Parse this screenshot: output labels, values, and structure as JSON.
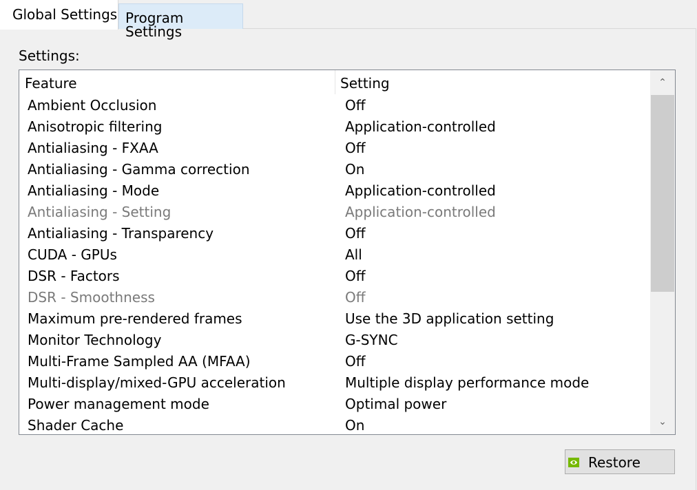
{
  "tabs": {
    "global": "Global Settings",
    "program": "Program Settings"
  },
  "settings_label": "Settings:",
  "table": {
    "columns": [
      "Feature",
      "Setting"
    ],
    "rows": [
      {
        "feature": "Ambient Occlusion",
        "setting": "Off",
        "enabled": true
      },
      {
        "feature": "Anisotropic filtering",
        "setting": "Application-controlled",
        "enabled": true
      },
      {
        "feature": "Antialiasing - FXAA",
        "setting": "Off",
        "enabled": true
      },
      {
        "feature": "Antialiasing - Gamma correction",
        "setting": "On",
        "enabled": true
      },
      {
        "feature": "Antialiasing - Mode",
        "setting": "Application-controlled",
        "enabled": true
      },
      {
        "feature": "Antialiasing - Setting",
        "setting": "Application-controlled",
        "enabled": false
      },
      {
        "feature": "Antialiasing - Transparency",
        "setting": "Off",
        "enabled": true
      },
      {
        "feature": "CUDA - GPUs",
        "setting": "All",
        "enabled": true
      },
      {
        "feature": "DSR - Factors",
        "setting": "Off",
        "enabled": true
      },
      {
        "feature": "DSR - Smoothness",
        "setting": "Off",
        "enabled": false
      },
      {
        "feature": "Maximum pre-rendered frames",
        "setting": "Use the 3D application setting",
        "enabled": true
      },
      {
        "feature": "Monitor Technology",
        "setting": "G-SYNC",
        "enabled": true
      },
      {
        "feature": "Multi-Frame Sampled AA (MFAA)",
        "setting": "Off",
        "enabled": true
      },
      {
        "feature": "Multi-display/mixed-GPU acceleration",
        "setting": "Multiple display performance mode",
        "enabled": true
      },
      {
        "feature": "Power management mode",
        "setting": "Optimal power",
        "enabled": true
      },
      {
        "feature": "Shader Cache",
        "setting": "On",
        "enabled": true
      }
    ]
  },
  "scrollbar": {
    "up_icon": "chevron-up-icon",
    "down_icon": "chevron-down-icon",
    "up_glyph": "⌃",
    "down_glyph": "⌄"
  },
  "restore_button": {
    "label": "Restore",
    "icon": "nvidia-logo-icon",
    "icon_color": "#76b900"
  }
}
